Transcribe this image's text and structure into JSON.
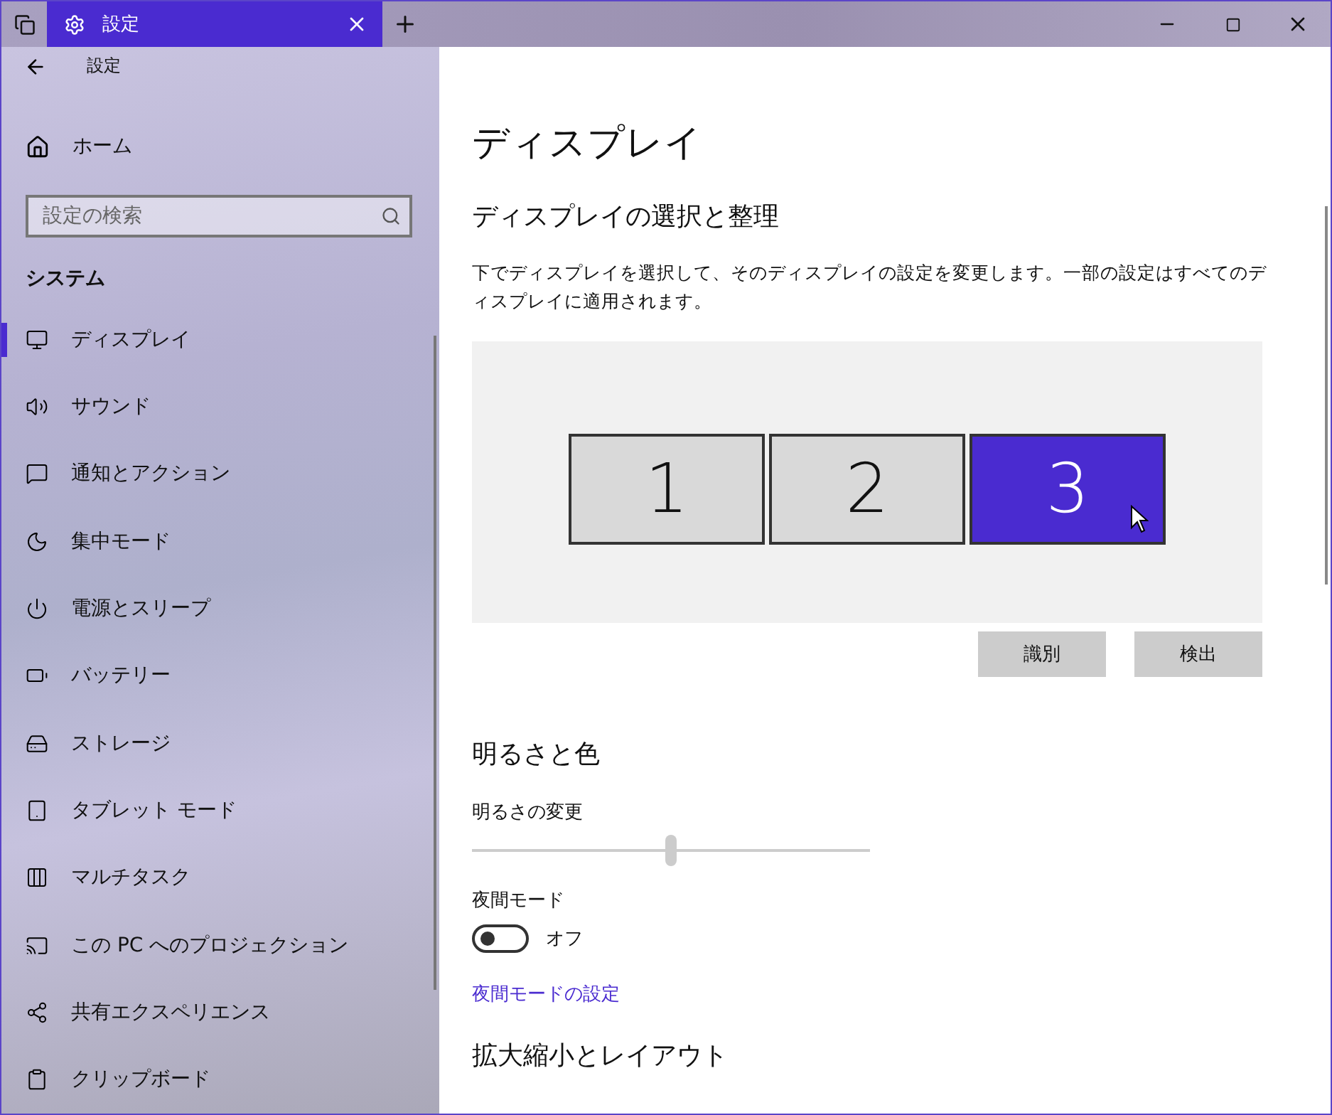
{
  "window": {
    "tab_title": "設定",
    "back_label": "設定"
  },
  "sidebar": {
    "home": "ホーム",
    "search": {
      "placeholder": "設定の検索"
    },
    "section": "システム",
    "items": [
      {
        "label": "ディスプレイ",
        "selected": true
      },
      {
        "label": "サウンド",
        "selected": false
      },
      {
        "label": "通知とアクション",
        "selected": false
      },
      {
        "label": "集中モード",
        "selected": false
      },
      {
        "label": "電源とスリープ",
        "selected": false
      },
      {
        "label": "バッテリー",
        "selected": false
      },
      {
        "label": "ストレージ",
        "selected": false
      },
      {
        "label": "タブレット モード",
        "selected": false
      },
      {
        "label": "マルチタスク",
        "selected": false
      },
      {
        "label": "この PC へのプロジェクション",
        "selected": false
      },
      {
        "label": "共有エクスペリエンス",
        "selected": false
      },
      {
        "label": "クリップボード",
        "selected": false
      }
    ]
  },
  "main": {
    "title": "ディスプレイ",
    "arrange_heading": "ディスプレイの選択と整理",
    "description": "下でディスプレイを選択して、そのディスプレイの設定を変更します。一部の設定はすべてのディスプレイに適用されます。",
    "monitors": [
      {
        "label": "1",
        "selected": false
      },
      {
        "label": "2",
        "selected": false
      },
      {
        "label": "3",
        "selected": true
      }
    ],
    "buttons": [
      "識別",
      "検出"
    ],
    "brightness_heading": "明るさと色",
    "brightness_label": "明るさの変更",
    "brightness": {
      "level": 0.5
    },
    "night_label": "夜間モード",
    "night_toggle": {
      "on": false,
      "state_text": "オフ"
    },
    "night_link": "夜間モードの設定",
    "scale_heading": "拡大縮小とレイアウト"
  }
}
